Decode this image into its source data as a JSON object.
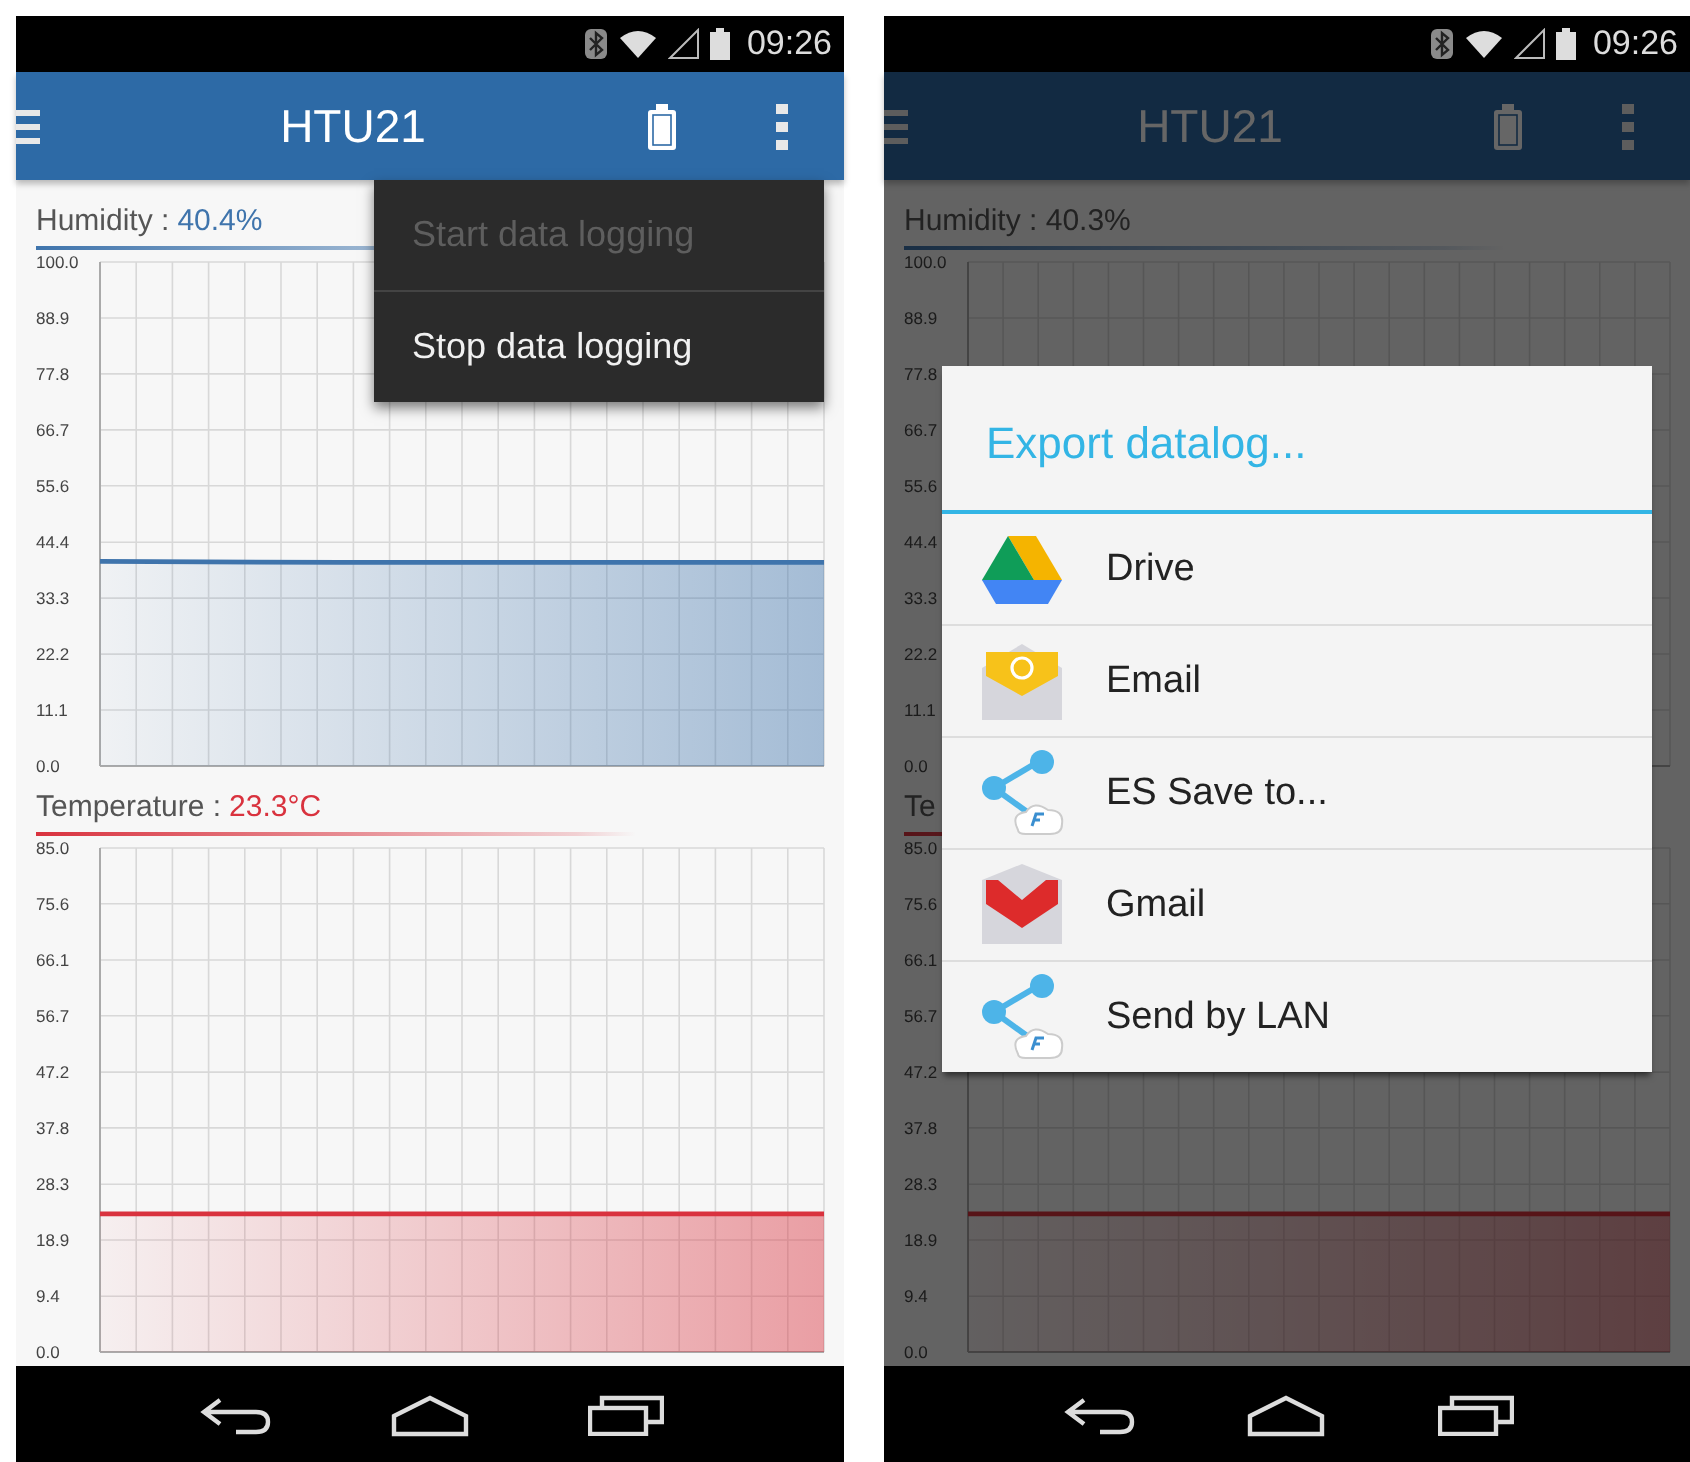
{
  "screens": [
    {
      "dimmed": false,
      "status_bar": {
        "time": "09:26"
      },
      "app_bar": {
        "title": "HTU21"
      },
      "charts": [
        {
          "label": "Humidity :",
          "value": "40.4%",
          "chart_data": {
            "type": "area",
            "ylim": [
              0,
              100
            ],
            "yticks": [
              {
                "value": 100,
                "label": "100.0"
              },
              {
                "value": 88.9,
                "label": "88.9"
              },
              {
                "value": 77.8,
                "label": "77.8"
              },
              {
                "value": 66.7,
                "label": "66.7"
              },
              {
                "value": 55.6,
                "label": "55.6"
              },
              {
                "value": 44.4,
                "label": "44.4"
              },
              {
                "value": 33.3,
                "label": "33.3"
              },
              {
                "value": 22.2,
                "label": "22.2"
              },
              {
                "value": 11.1,
                "label": "11.1"
              },
              {
                "value": 0,
                "label": "0.0"
              }
            ],
            "grid": true,
            "series": [
              {
                "color": "#3f74ac",
                "values": [
                  40.6,
                  40.4,
                  40.4,
                  40.4
                ]
              }
            ]
          }
        },
        {
          "label": "Temperature :",
          "value": "23.3°C",
          "chart_data": {
            "type": "area",
            "ylim": [
              0,
              85
            ],
            "yticks": [
              {
                "value": 85,
                "label": "85.0"
              },
              {
                "value": 75.6,
                "label": "75.6"
              },
              {
                "value": 66.1,
                "label": "66.1"
              },
              {
                "value": 56.7,
                "label": "56.7"
              },
              {
                "value": 47.2,
                "label": "47.2"
              },
              {
                "value": 37.8,
                "label": "37.8"
              },
              {
                "value": 28.3,
                "label": "28.3"
              },
              {
                "value": 18.9,
                "label": "18.9"
              },
              {
                "value": 9.4,
                "label": "9.4"
              },
              {
                "value": 0,
                "label": "0.0"
              }
            ],
            "grid": true,
            "series": [
              {
                "color": "#d9323e",
                "values": [
                  23.3,
                  23.3,
                  23.3,
                  23.3
                ]
              }
            ]
          }
        }
      ],
      "menu": {
        "items": [
          {
            "label": "Start data logging",
            "disabled": true
          },
          {
            "label": "Stop data logging",
            "disabled": false
          }
        ]
      }
    },
    {
      "dimmed": true,
      "status_bar": {
        "time": "09:26"
      },
      "app_bar": {
        "title": "HTU21"
      },
      "charts": [
        {
          "label": "Humidity : 40.3%",
          "grid": true,
          "tick_labels": [
            "100.0",
            "88.9",
            "77.8",
            "66.7",
            "55.6",
            "44.4",
            "33.3",
            "22.2",
            "11.1",
            "0.0"
          ]
        },
        {
          "label": "Te",
          "chart_data": {
            "type": "area",
            "ylim": [
              0,
              85
            ],
            "yticks": [
              {
                "value": 85,
                "label": "85.0"
              },
              {
                "value": 75.6,
                "label": "75.6"
              },
              {
                "value": 66.1,
                "label": "66.1"
              },
              {
                "value": 56.7,
                "label": "56.7"
              },
              {
                "value": 47.2,
                "label": "47.2"
              },
              {
                "value": 37.8,
                "label": "37.8"
              },
              {
                "value": 28.3,
                "label": "28.3"
              },
              {
                "value": 18.9,
                "label": "18.9"
              },
              {
                "value": 9.4,
                "label": "9.4"
              },
              {
                "value": 0,
                "label": "0.0"
              }
            ],
            "grid": true,
            "series": [
              {
                "color": "#d9323e",
                "values": [
                  23.3,
                  23.3,
                  23.3,
                  23.3
                ]
              }
            ]
          }
        }
      ],
      "dialog": {
        "title": "Export datalog...",
        "items": [
          {
            "kind": "drive",
            "label": "Drive"
          },
          {
            "kind": "email",
            "label": "Email"
          },
          {
            "kind": "share",
            "label": "ES Save to..."
          },
          {
            "kind": "gmail",
            "label": "Gmail"
          },
          {
            "kind": "share",
            "label": "Send by LAN"
          }
        ]
      }
    }
  ]
}
